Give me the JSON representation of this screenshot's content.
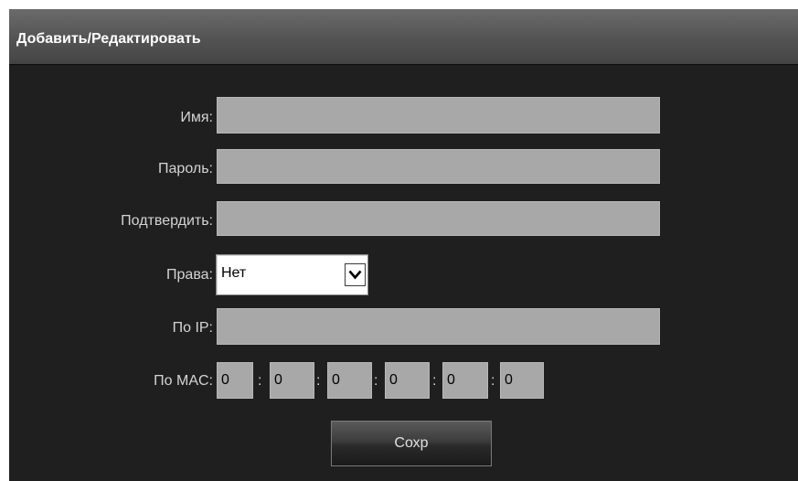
{
  "dialog": {
    "title": "Добавить/Редактировать"
  },
  "form": {
    "name_label": "Имя:",
    "name_value": "",
    "password_label": "Пароль:",
    "password_value": "",
    "confirm_label": "Подтвердить:",
    "confirm_value": "",
    "rights_label": "Права:",
    "rights_value": "Нет",
    "ip_label": "По IP:",
    "ip_value": "",
    "mac_label": "По MAC:",
    "mac_separator": ":",
    "mac_octets": [
      "0",
      "0",
      "0",
      "0",
      "0",
      "0"
    ]
  },
  "buttons": {
    "save_label": "Сохр"
  }
}
